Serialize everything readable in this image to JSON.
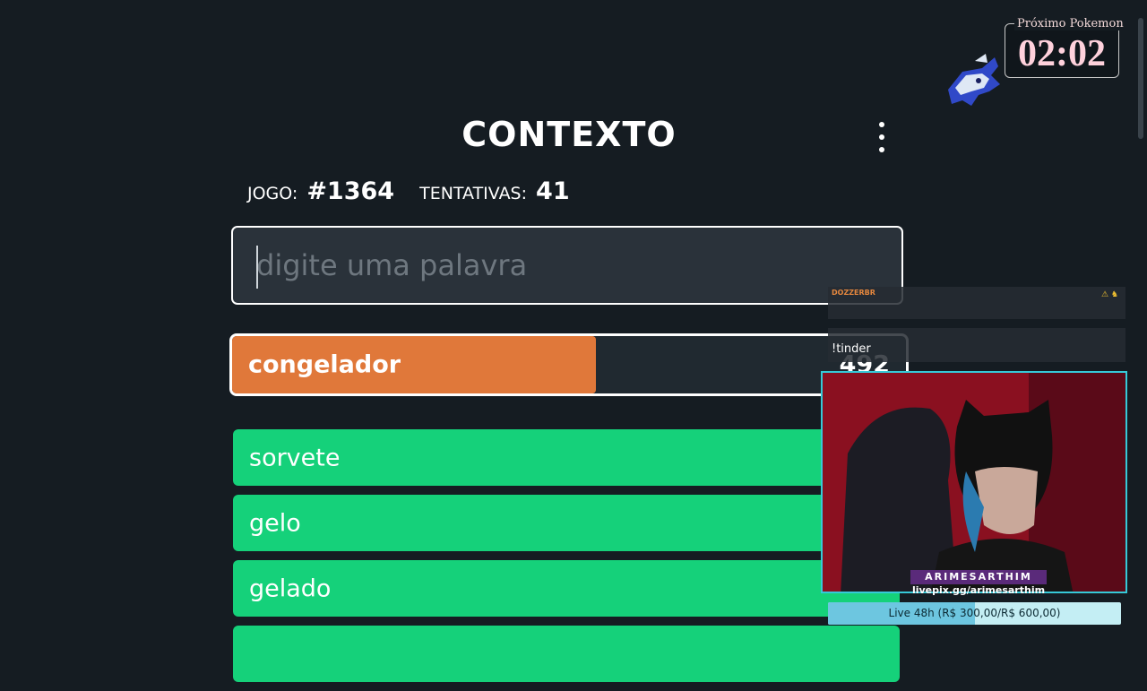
{
  "header": {
    "title": "CONTEXTO"
  },
  "stats": {
    "game_label": "JOGO:",
    "game_value": "#1364",
    "attempts_label": "TENTATIVAS:",
    "attempts_value": "41"
  },
  "input": {
    "placeholder": "digite uma palavra",
    "value": ""
  },
  "last_guess": {
    "word": "congelador",
    "rank": "492",
    "bar_fraction": 0.54,
    "color": "#e0783a"
  },
  "guesses": [
    {
      "word": "sorvete",
      "color": "#15d17a"
    },
    {
      "word": "gelo",
      "color": "#15d17a"
    },
    {
      "word": "gelado",
      "color": "#15d17a"
    }
  ],
  "overlay": {
    "next_pokemon_label": "Próximo Pokemon",
    "timer": "02:02",
    "chat": [
      {
        "user": "DOZZERBR",
        "message": ""
      },
      {
        "user": "",
        "message": "!tinder"
      }
    ],
    "webcam": {
      "name": "ARIMESARTHIM",
      "link": "livepix.gg/arimesarthim"
    },
    "goal": {
      "text": "Live 48h (R$ 300,00/R$ 600,00)",
      "progress": 0.5
    }
  }
}
